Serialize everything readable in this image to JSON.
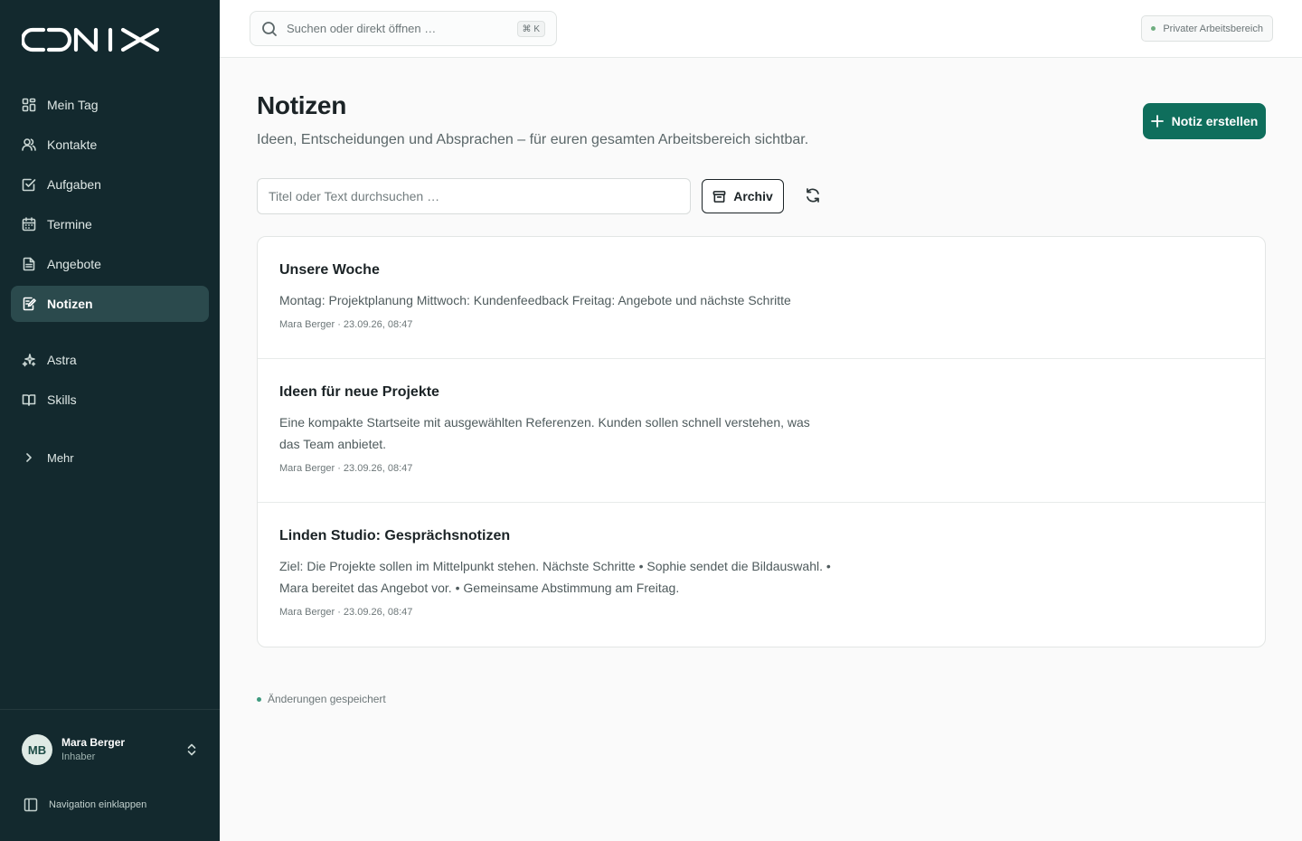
{
  "app": {
    "logo_text": "ONIX"
  },
  "sidebar": {
    "items": [
      {
        "label": "Mein Tag",
        "icon": "dashboard-icon"
      },
      {
        "label": "Kontakte",
        "icon": "users-icon"
      },
      {
        "label": "Aufgaben",
        "icon": "checkbox-icon"
      },
      {
        "label": "Termine",
        "icon": "calendar-icon"
      },
      {
        "label": "Angebote",
        "icon": "document-icon"
      },
      {
        "label": "Notizen",
        "icon": "note-edit-icon",
        "active": true
      },
      {
        "label": "Astra",
        "icon": "sparkles-icon"
      },
      {
        "label": "Skills",
        "icon": "book-icon"
      }
    ],
    "more_label": "Mehr",
    "user": {
      "initials": "MB",
      "name": "Mara Berger",
      "role": "Inhaber"
    },
    "collapse_label": "Navigation einklappen"
  },
  "topbar": {
    "search_placeholder": "Suchen oder direkt öffnen …",
    "shortcut": "⌘ K",
    "workspace_label": "Privater Arbeitsbereich"
  },
  "page": {
    "title": "Notizen",
    "subtitle": "Ideen, Entscheidungen und Absprachen – für euren gesamten Arbeitsbereich sichtbar.",
    "create_label": "Notiz erstellen",
    "filter_placeholder": "Titel oder Text durchsuchen …",
    "archive_label": "Archiv",
    "saved_status": "Änderungen gespeichert"
  },
  "notes": [
    {
      "title": "Unsere Woche",
      "body": "Montag: Projektplanung Mittwoch: Kundenfeedback Freitag: Angebote und nächste Schritte",
      "meta": "Mara Berger · 23.09.26, 08:47"
    },
    {
      "title": "Ideen für neue Projekte",
      "body": "Eine kompakte Startseite mit ausgewählten Referenzen. Kunden sollen schnell verstehen, was das Team anbietet.",
      "meta": "Mara Berger · 23.09.26, 08:47"
    },
    {
      "title": "Linden Studio: Gesprächsnotizen",
      "body": "Ziel: Die Projekte sollen im Mittelpunkt stehen. Nächste Schritte • Sophie sendet die Bildauswahl. • Mara bereitet das Angebot vor. • Gemeinsame Abstimmung am Freitag.",
      "meta": "Mara Berger · 23.09.26, 08:47"
    }
  ],
  "colors": {
    "sidebar_bg": "#13292e",
    "sidebar_active": "#2b4a4d",
    "accent": "#0f6e5c",
    "status_dot": "#3e9a7e"
  }
}
